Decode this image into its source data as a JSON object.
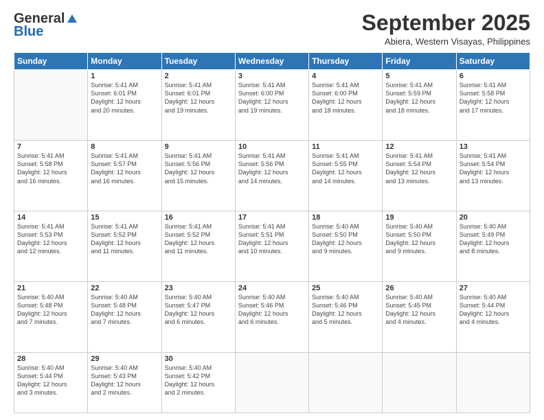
{
  "logo": {
    "general": "General",
    "blue": "Blue"
  },
  "title": "September 2025",
  "location": "Abiera, Western Visayas, Philippines",
  "days": [
    "Sunday",
    "Monday",
    "Tuesday",
    "Wednesday",
    "Thursday",
    "Friday",
    "Saturday"
  ],
  "weeks": [
    [
      {
        "day": "",
        "info": ""
      },
      {
        "day": "1",
        "info": "Sunrise: 5:41 AM\nSunset: 6:01 PM\nDaylight: 12 hours\nand 20 minutes."
      },
      {
        "day": "2",
        "info": "Sunrise: 5:41 AM\nSunset: 6:01 PM\nDaylight: 12 hours\nand 19 minutes."
      },
      {
        "day": "3",
        "info": "Sunrise: 5:41 AM\nSunset: 6:00 PM\nDaylight: 12 hours\nand 19 minutes."
      },
      {
        "day": "4",
        "info": "Sunrise: 5:41 AM\nSunset: 6:00 PM\nDaylight: 12 hours\nand 18 minutes."
      },
      {
        "day": "5",
        "info": "Sunrise: 5:41 AM\nSunset: 5:59 PM\nDaylight: 12 hours\nand 18 minutes."
      },
      {
        "day": "6",
        "info": "Sunrise: 5:41 AM\nSunset: 5:58 PM\nDaylight: 12 hours\nand 17 minutes."
      }
    ],
    [
      {
        "day": "7",
        "info": "Sunrise: 5:41 AM\nSunset: 5:58 PM\nDaylight: 12 hours\nand 16 minutes."
      },
      {
        "day": "8",
        "info": "Sunrise: 5:41 AM\nSunset: 5:57 PM\nDaylight: 12 hours\nand 16 minutes."
      },
      {
        "day": "9",
        "info": "Sunrise: 5:41 AM\nSunset: 5:56 PM\nDaylight: 12 hours\nand 15 minutes."
      },
      {
        "day": "10",
        "info": "Sunrise: 5:41 AM\nSunset: 5:56 PM\nDaylight: 12 hours\nand 14 minutes."
      },
      {
        "day": "11",
        "info": "Sunrise: 5:41 AM\nSunset: 5:55 PM\nDaylight: 12 hours\nand 14 minutes."
      },
      {
        "day": "12",
        "info": "Sunrise: 5:41 AM\nSunset: 5:54 PM\nDaylight: 12 hours\nand 13 minutes."
      },
      {
        "day": "13",
        "info": "Sunrise: 5:41 AM\nSunset: 5:54 PM\nDaylight: 12 hours\nand 13 minutes."
      }
    ],
    [
      {
        "day": "14",
        "info": "Sunrise: 5:41 AM\nSunset: 5:53 PM\nDaylight: 12 hours\nand 12 minutes."
      },
      {
        "day": "15",
        "info": "Sunrise: 5:41 AM\nSunset: 5:52 PM\nDaylight: 12 hours\nand 11 minutes."
      },
      {
        "day": "16",
        "info": "Sunrise: 5:41 AM\nSunset: 5:52 PM\nDaylight: 12 hours\nand 11 minutes."
      },
      {
        "day": "17",
        "info": "Sunrise: 5:41 AM\nSunset: 5:51 PM\nDaylight: 12 hours\nand 10 minutes."
      },
      {
        "day": "18",
        "info": "Sunrise: 5:40 AM\nSunset: 5:50 PM\nDaylight: 12 hours\nand 9 minutes."
      },
      {
        "day": "19",
        "info": "Sunrise: 5:40 AM\nSunset: 5:50 PM\nDaylight: 12 hours\nand 9 minutes."
      },
      {
        "day": "20",
        "info": "Sunrise: 5:40 AM\nSunset: 5:49 PM\nDaylight: 12 hours\nand 8 minutes."
      }
    ],
    [
      {
        "day": "21",
        "info": "Sunrise: 5:40 AM\nSunset: 5:48 PM\nDaylight: 12 hours\nand 7 minutes."
      },
      {
        "day": "22",
        "info": "Sunrise: 5:40 AM\nSunset: 5:48 PM\nDaylight: 12 hours\nand 7 minutes."
      },
      {
        "day": "23",
        "info": "Sunrise: 5:40 AM\nSunset: 5:47 PM\nDaylight: 12 hours\nand 6 minutes."
      },
      {
        "day": "24",
        "info": "Sunrise: 5:40 AM\nSunset: 5:46 PM\nDaylight: 12 hours\nand 6 minutes."
      },
      {
        "day": "25",
        "info": "Sunrise: 5:40 AM\nSunset: 5:46 PM\nDaylight: 12 hours\nand 5 minutes."
      },
      {
        "day": "26",
        "info": "Sunrise: 5:40 AM\nSunset: 5:45 PM\nDaylight: 12 hours\nand 4 minutes."
      },
      {
        "day": "27",
        "info": "Sunrise: 5:40 AM\nSunset: 5:44 PM\nDaylight: 12 hours\nand 4 minutes."
      }
    ],
    [
      {
        "day": "28",
        "info": "Sunrise: 5:40 AM\nSunset: 5:44 PM\nDaylight: 12 hours\nand 3 minutes."
      },
      {
        "day": "29",
        "info": "Sunrise: 5:40 AM\nSunset: 5:43 PM\nDaylight: 12 hours\nand 2 minutes."
      },
      {
        "day": "30",
        "info": "Sunrise: 5:40 AM\nSunset: 5:42 PM\nDaylight: 12 hours\nand 2 minutes."
      },
      {
        "day": "",
        "info": ""
      },
      {
        "day": "",
        "info": ""
      },
      {
        "day": "",
        "info": ""
      },
      {
        "day": "",
        "info": ""
      }
    ]
  ]
}
